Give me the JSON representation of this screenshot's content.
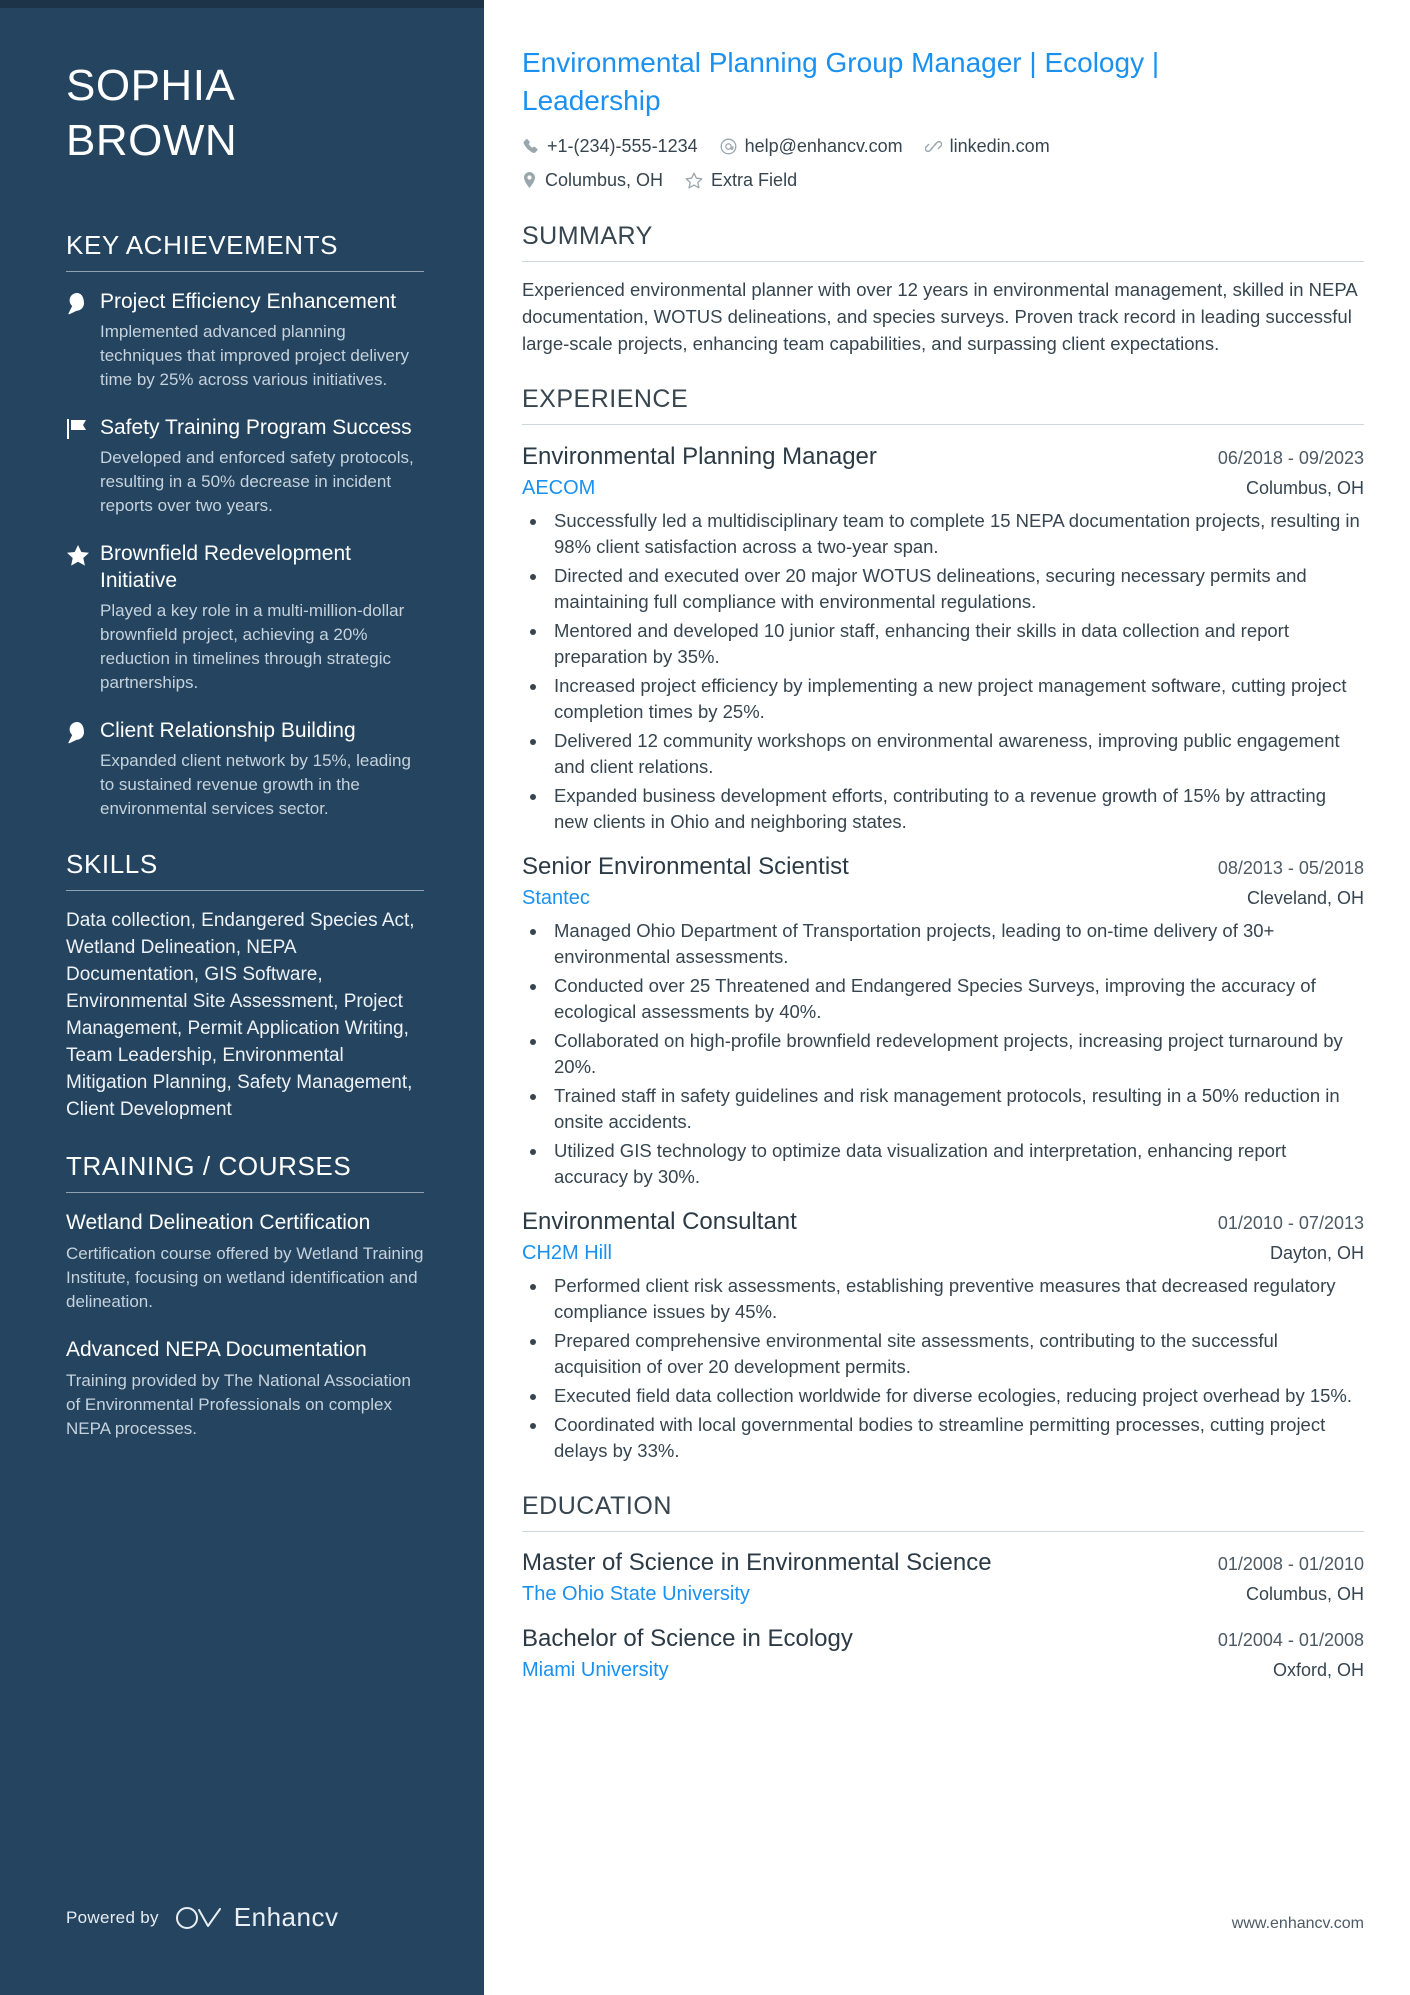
{
  "theme": {
    "sidebar_bg": "#24445f",
    "accent_blue": "#1a91f0",
    "body_text": "#36454f"
  },
  "sidebar": {
    "name_first": "SOPHIA",
    "name_last": "BROWN",
    "key_achievements": {
      "heading": "KEY ACHIEVEMENTS",
      "items": [
        {
          "icon": "lightbulb-icon",
          "title": "Project Efficiency Enhancement",
          "desc": "Implemented advanced planning techniques that improved project delivery time by 25% across various initiatives."
        },
        {
          "icon": "flag-icon",
          "title": "Safety Training Program Success",
          "desc": "Developed and enforced safety protocols, resulting in a 50% decrease in incident reports over two years."
        },
        {
          "icon": "star-icon",
          "title": "Brownfield Redevelopment Initiative",
          "desc": "Played a key role in a multi-million-dollar brownfield project, achieving a 20% reduction in timelines through strategic partnerships."
        },
        {
          "icon": "lightbulb-icon",
          "title": "Client Relationship Building",
          "desc": "Expanded client network by 15%, leading to sustained revenue growth in the environmental services sector."
        }
      ]
    },
    "skills": {
      "heading": "SKILLS",
      "text": "Data collection, Endangered Species Act, Wetland Delineation, NEPA Documentation, GIS Software, Environmental Site Assessment, Project Management, Permit Application Writing, Team Leadership, Environmental Mitigation Planning, Safety Management, Client Development"
    },
    "training": {
      "heading": "TRAINING / COURSES",
      "items": [
        {
          "title": "Wetland Delineation Certification",
          "desc": "Certification course offered by Wetland Training Institute, focusing on wetland identification and delineation."
        },
        {
          "title": "Advanced NEPA Documentation",
          "desc": "Training provided by The National Association of Environmental Professionals on complex NEPA processes."
        }
      ]
    },
    "footer": {
      "powered_by": "Powered by",
      "brand": "Enhancv"
    }
  },
  "main": {
    "headline": "Environmental Planning Group Manager | Ecology | Leadership",
    "contacts": [
      {
        "icon": "phone-icon",
        "text": "+1-(234)-555-1234"
      },
      {
        "icon": "email-icon",
        "text": "help@enhancv.com"
      },
      {
        "icon": "link-icon",
        "text": "linkedin.com"
      },
      {
        "icon": "location-pin-icon",
        "text": "Columbus, OH"
      },
      {
        "icon": "star-outline-icon",
        "text": "Extra Field"
      }
    ],
    "summary": {
      "heading": "SUMMARY",
      "text": "Experienced environmental planner with over 12 years in environmental management, skilled in NEPA documentation, WOTUS delineations, and species surveys. Proven track record in leading successful large-scale projects, enhancing team capabilities, and surpassing client expectations."
    },
    "experience": {
      "heading": "EXPERIENCE",
      "entries": [
        {
          "title": "Environmental Planning Manager",
          "date": "06/2018 - 09/2023",
          "org": "AECOM",
          "location": "Columbus, OH",
          "bullets": [
            "Successfully led a multidisciplinary team to complete 15 NEPA documentation projects, resulting in 98% client satisfaction across a two-year span.",
            "Directed and executed over 20 major WOTUS delineations, securing necessary permits and maintaining full compliance with environmental regulations.",
            "Mentored and developed 10 junior staff, enhancing their skills in data collection and report preparation by 35%.",
            "Increased project efficiency by implementing a new project management software, cutting project completion times by 25%.",
            "Delivered 12 community workshops on environmental awareness, improving public engagement and client relations.",
            "Expanded business development efforts, contributing to a revenue growth of 15% by attracting new clients in Ohio and neighboring states."
          ]
        },
        {
          "title": "Senior Environmental Scientist",
          "date": "08/2013 - 05/2018",
          "org": "Stantec",
          "location": "Cleveland, OH",
          "bullets": [
            "Managed Ohio Department of Transportation projects, leading to on-time delivery of 30+ environmental assessments.",
            "Conducted over 25 Threatened and Endangered Species Surveys, improving the accuracy of ecological assessments by 40%.",
            "Collaborated on high-profile brownfield redevelopment projects, increasing project turnaround by 20%.",
            "Trained staff in safety guidelines and risk management protocols, resulting in a 50% reduction in onsite accidents.",
            "Utilized GIS technology to optimize data visualization and interpretation, enhancing report accuracy by 30%."
          ]
        },
        {
          "title": "Environmental Consultant",
          "date": "01/2010 - 07/2013",
          "org": "CH2M Hill",
          "location": "Dayton, OH",
          "bullets": [
            "Performed client risk assessments, establishing preventive measures that decreased regulatory compliance issues by 45%.",
            "Prepared comprehensive environmental site assessments, contributing to the successful acquisition of over 20 development permits.",
            "Executed field data collection worldwide for diverse ecologies, reducing project overhead by 15%.",
            "Coordinated with local governmental bodies to streamline permitting processes, cutting project delays by 33%."
          ]
        }
      ]
    },
    "education": {
      "heading": "EDUCATION",
      "entries": [
        {
          "title": "Master of Science in Environmental Science",
          "date": "01/2008 - 01/2010",
          "org": "The Ohio State University",
          "location": "Columbus, OH"
        },
        {
          "title": "Bachelor of Science in Ecology",
          "date": "01/2004 - 01/2008",
          "org": "Miami University",
          "location": "Oxford, OH"
        }
      ]
    },
    "footer_url": "www.enhancv.com"
  }
}
